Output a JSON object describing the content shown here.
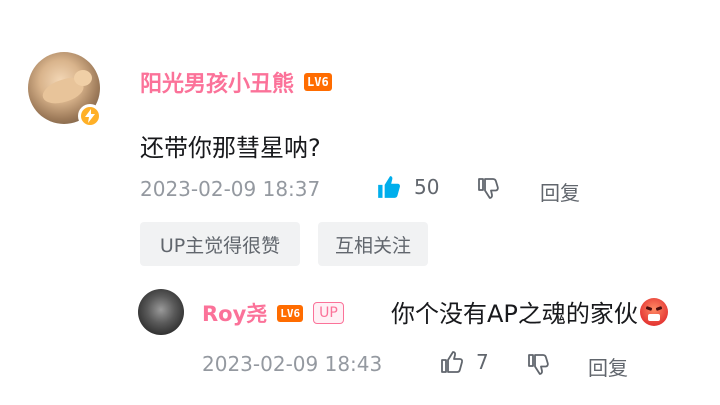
{
  "comment": {
    "user": {
      "name": "阳光男孩小丑熊",
      "level": "LV6",
      "badge_icon": "lightning-icon"
    },
    "text": "还带你那彗星呐?",
    "timestamp": "2023-02-09 18:37",
    "like_count": "50",
    "liked": true,
    "reply_label": "回复",
    "chips": [
      "UP主觉得很赞",
      "互相关注"
    ]
  },
  "reply": {
    "user": {
      "name": "Roy尧",
      "level": "LV6",
      "up_badge": "UP"
    },
    "text": "你个没有AP之魂的家伙",
    "emoji": "angry-face-emoji",
    "timestamp": "2023-02-09 18:43",
    "like_count": "7",
    "reply_label": "回复"
  },
  "colors": {
    "username": "#fb7299",
    "level": "#ff6c00",
    "liked": "#00aeec",
    "meta": "#9499a0",
    "chip_bg": "#f1f2f3"
  }
}
